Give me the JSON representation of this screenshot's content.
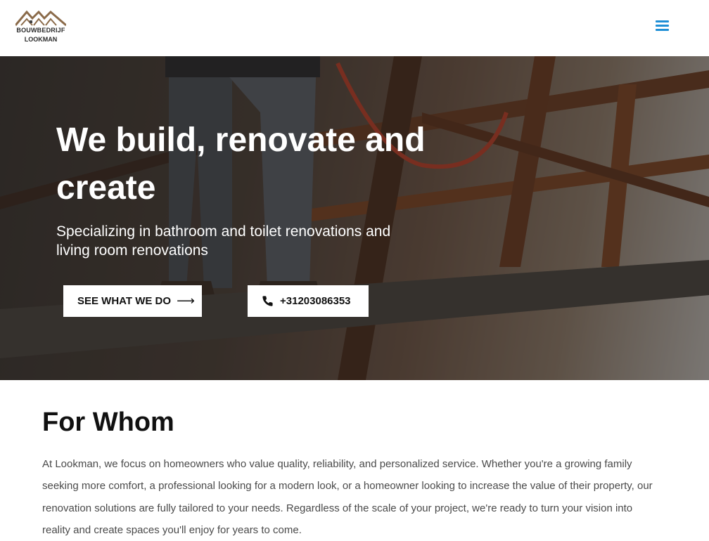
{
  "header": {
    "logo": {
      "line1": "BOUWBEDRIJF",
      "line2": "LOOKMAN"
    },
    "menu_icon": "hamburger-menu-icon"
  },
  "hero": {
    "title": "We build, renovate and create",
    "subtitle": "Specializing in bathroom and toilet renovations and living room renovations",
    "primary_button": {
      "label": "SEE WHAT WE DO",
      "icon": "arrow-right-icon"
    },
    "phone_button": {
      "label": "+31203086353",
      "icon": "phone-icon"
    }
  },
  "section": {
    "title": "For Whom",
    "text": "At Lookman, we focus on homeowners who value quality, reliability, and personalized service. Whether you're a growing family seeking more comfort, a professional looking for a modern look, or a homeowner looking to increase the value of their property, our renovation solutions are fully tailored to your needs. Regardless of the scale of your project, we're ready to turn your vision into reality and create spaces you'll enjoy for years to come."
  },
  "colors": {
    "accent": "#1f8fd6",
    "logo_roof": "#8b6b4a",
    "button_bg": "#ffffff"
  }
}
